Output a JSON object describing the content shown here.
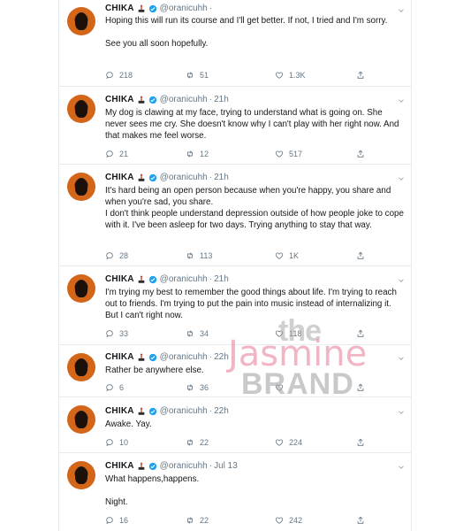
{
  "account": {
    "name": "CHIKA",
    "handle": "@oranicuhh"
  },
  "tweets": [
    {
      "time": "",
      "text": "Hoping this will run its course and I'll get better. If not, I tried and I'm sorry.\n\nSee you all soon hopefully.",
      "replies": "218",
      "retweets": "51",
      "likes": "1.3K"
    },
    {
      "time": "21h",
      "text": "My dog is clawing at my face, trying to understand what is going on. She never sees me cry. She doesn't know why I can't play with her right now. And that makes me feel worse.",
      "replies": "21",
      "retweets": "12",
      "likes": "517"
    },
    {
      "time": "21h",
      "text": "It's hard being an open person because when you're happy, you share and when you're sad, you share.\nI don't think people understand depression outside of how people joke to cope with it. I've been asleep for two days. Trying anything to stay that way.",
      "replies": "28",
      "retweets": "113",
      "likes": "1K"
    },
    {
      "time": "21h",
      "text": "I'm trying my best to remember the good things about life. I'm trying to reach out to friends. I'm trying to put the pain into music instead of internalizing it. But I can't right now.",
      "replies": "33",
      "retweets": "34",
      "likes": "118"
    },
    {
      "time": "22h",
      "text": "Rather be anywhere else.",
      "replies": "6",
      "retweets": "36",
      "likes": ""
    },
    {
      "time": "22h",
      "text": "Awake. Yay.",
      "replies": "10",
      "retweets": "22",
      "likes": "224"
    },
    {
      "time": "Jul 13",
      "text": "What happens,happens.\n\nNight.",
      "replies": "16",
      "retweets": "22",
      "likes": "242"
    }
  ],
  "watermark": {
    "line1": "the",
    "line2": "Jasmine",
    "line3": "BRAND"
  },
  "colors": {
    "muted": "#657786",
    "verified": "#1da1f2",
    "border": "#e6ecf0"
  },
  "icons": {
    "reply": "reply-icon",
    "retweet": "retweet-icon",
    "like": "like-icon",
    "share": "share-icon",
    "verified": "verified-icon",
    "more": "chevron-down-icon"
  }
}
